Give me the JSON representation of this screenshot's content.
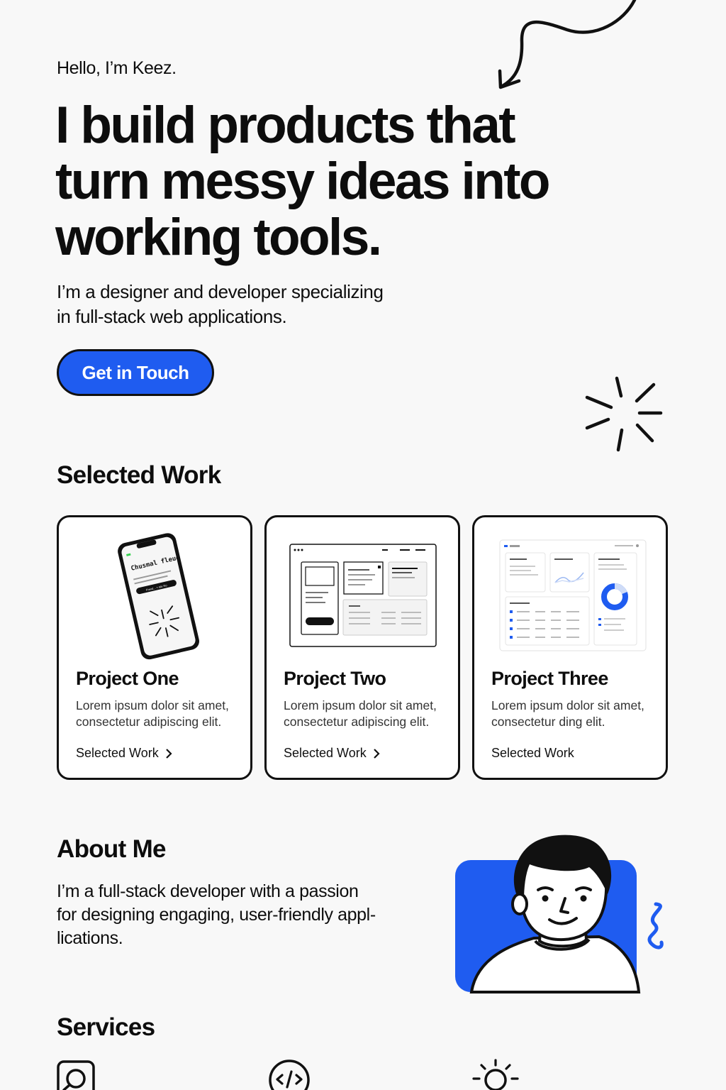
{
  "hero": {
    "greeting": "Hello, I’m Keez.",
    "headline": [
      "I build products that",
      "turn messy ideas into",
      "working tools."
    ],
    "subtitle_lines": [
      "I’m a designer and developer specializing",
      "in full-stack web applications."
    ],
    "cta_label": "Get in Touch"
  },
  "work": {
    "title": "Selected Work",
    "projects": [
      {
        "title": "Project One",
        "description": "Lorem ipsum dolor sit amet, consectetur adipiscing elit.",
        "link_label": "Selected Work",
        "has_chevron": true,
        "thumb": "phone-mockup",
        "mockup_heading": "Chusmal fleue",
        "mockup_button": "Frend... > Ale Ro"
      },
      {
        "title": "Project Two",
        "description": "Lorem ipsum dolor sit amet, consectetur adipiscing elit.",
        "link_label": "Selected Work",
        "has_chevron": true,
        "thumb": "browser-mockup"
      },
      {
        "title": "Project Three",
        "description": "Lorem ipsum dolor sit amet, consectetur ding elit.",
        "link_label": "Selected Work",
        "has_chevron": false,
        "thumb": "dashboard-mockup"
      }
    ]
  },
  "about": {
    "title": "About Me",
    "text_lines": [
      "I’m a full-stack developer with a passion",
      "for designing engaging, user-friendly appl-",
      "lications."
    ]
  },
  "services": {
    "title": "Services",
    "icons": [
      "search-icon",
      "code-icon",
      "lightbulb-icon"
    ]
  },
  "colors": {
    "accent": "#1f5cf0",
    "ink": "#111111",
    "background": "#f8f8f8"
  }
}
